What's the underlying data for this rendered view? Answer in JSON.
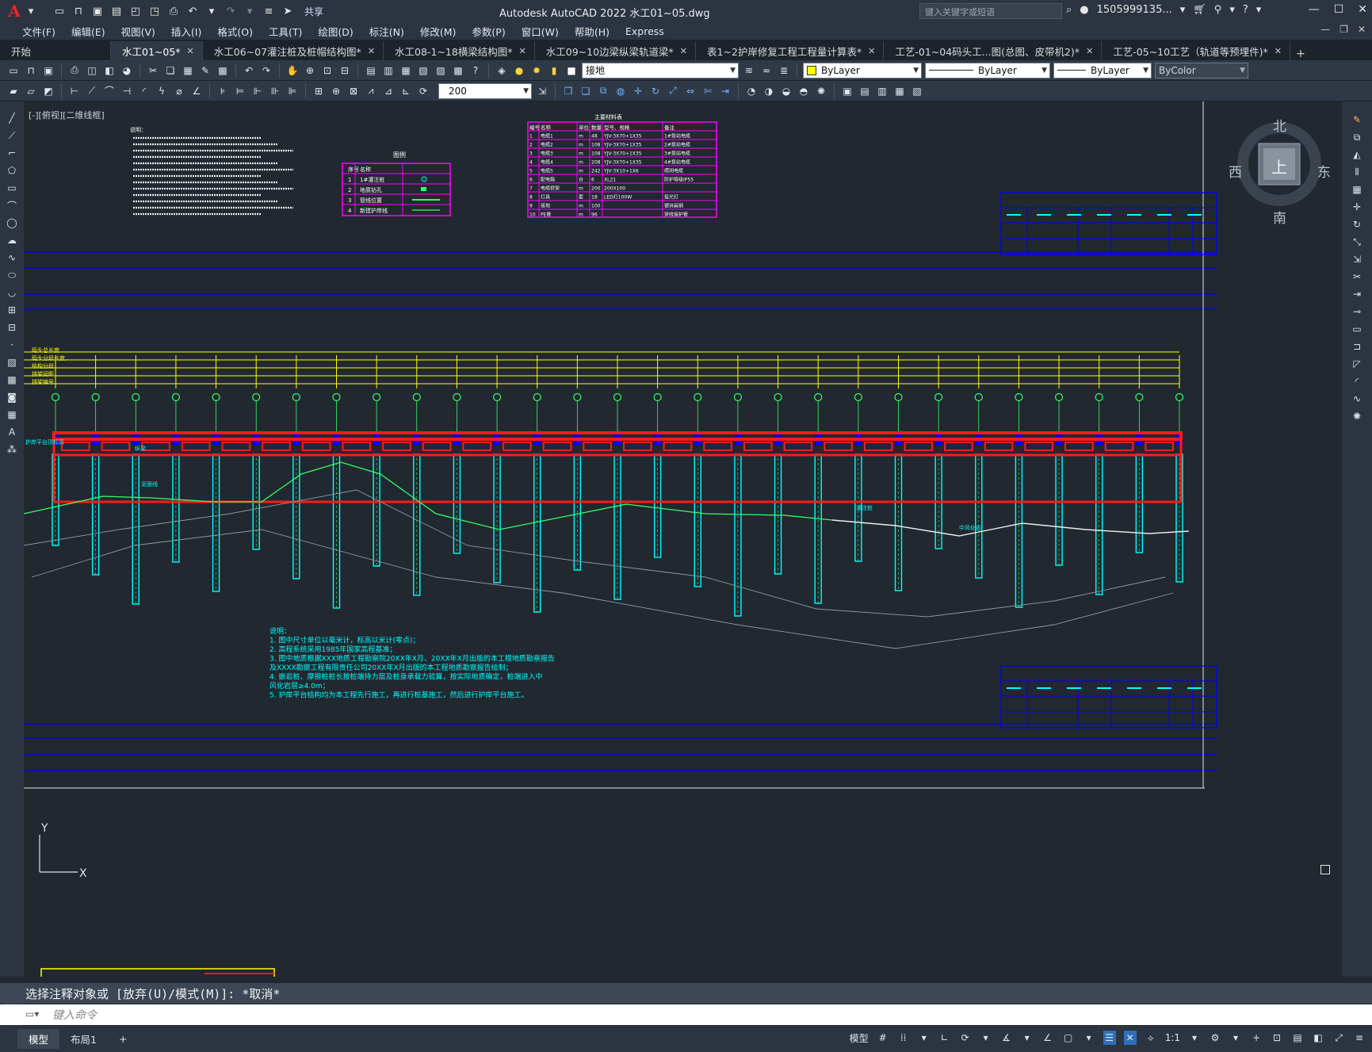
{
  "app": {
    "logo": "A",
    "title": "Autodesk AutoCAD 2022    水工01~05.dwg",
    "share": "共享",
    "search_placeholder": "键入关键字或短语",
    "user": "1505999135...",
    "cart_icon": "cart-icon",
    "help_icon": "help-icon"
  },
  "menus": [
    "文件(F)",
    "编辑(E)",
    "视图(V)",
    "插入(I)",
    "格式(O)",
    "工具(T)",
    "绘图(D)",
    "标注(N)",
    "修改(M)",
    "参数(P)",
    "窗口(W)",
    "帮助(H)",
    "Express"
  ],
  "tabs": [
    {
      "label": "开始",
      "active": false,
      "closable": false
    },
    {
      "label": "水工01~05*",
      "active": true,
      "closable": true
    },
    {
      "label": "水工06~07灌注桩及桩帽结构图*",
      "active": false,
      "closable": true
    },
    {
      "label": "水工08-1~18横梁结构图*",
      "active": false,
      "closable": true
    },
    {
      "label": "水工09~10边梁纵梁轨道梁*",
      "active": false,
      "closable": true
    },
    {
      "label": "表1~2护岸修复工程工程量计算表*",
      "active": false,
      "closable": true
    },
    {
      "label": "工艺-01~04码头工...图(总图、皮带机2)*",
      "active": false,
      "closable": true
    },
    {
      "label": "工艺-05~10工艺（轨道等预埋件)*",
      "active": false,
      "closable": true
    }
  ],
  "toolbar": {
    "layer": "接地",
    "color": "ByLayer",
    "linetype": "ByLayer",
    "lineweight": "ByLayer",
    "plotstyle": "ByColor",
    "dimscale": "200"
  },
  "viewport": {
    "label": "[-][俯视][二维线框]",
    "compass": {
      "north": "北",
      "south": "南",
      "east": "东",
      "west": "西",
      "top": "上"
    },
    "ucs": {
      "x": "X",
      "y": "Y"
    }
  },
  "drawing": {
    "notes_title": "说明：",
    "notes_bottom": [
      "说明：",
      "1. 图中尺寸单位以毫米计，标高以米计(零点)；",
      "2. 高程系统采用1985年国家高程基准；",
      "3. 图中地质根据XXX地质工程勘察院20XX年X月、20XX年X月出版的本工程地质勘察报告",
      "   及XXXX勘察工程有限责任公司20XX年X月出版的本工程地质勘察报告绘制；",
      "4. 嵌岩桩、摩擦桩桩长按桩端持力层及桩身承载力验算，按实际地质确定，桩端进入中",
      "   风化岩层≥4.0m；",
      "5. 护岸平台结构均为本工程先行施工，再进行桩基施工，然后进行护岸平台施工。"
    ],
    "legend_title": "图例",
    "legend": [
      {
        "no": "序号",
        "name": "名称",
        "symbol": "图例"
      },
      {
        "no": "1",
        "name": "1#灌注桩",
        "symbol": ""
      },
      {
        "no": "2",
        "name": "地质钻孔",
        "symbol": ""
      },
      {
        "no": "3",
        "name": "管线位置",
        "symbol": ""
      },
      {
        "no": "4",
        "name": "新建护岸线",
        "symbol": ""
      }
    ],
    "table_title": "主要材料表",
    "table_headers": [
      "编号",
      "名称",
      "单位",
      "数量",
      "型号、规格",
      "备注"
    ],
    "table_rows": [
      [
        "1",
        "电缆1",
        "m",
        "48",
        "YJV-3X70+1X35",
        "1#泵站电缆"
      ],
      [
        "2",
        "电缆2",
        "m",
        "108",
        "YJV-3X70+1X35",
        "2#泵站电缆"
      ],
      [
        "3",
        "电缆3",
        "m",
        "108",
        "YJV-3X70+1X35",
        "3#泵站电缆"
      ],
      [
        "4",
        "电缆4",
        "m",
        "208",
        "YJV-3X70+1X35",
        "4#泵站电缆"
      ],
      [
        "5",
        "电缆5",
        "m",
        "242",
        "YJV-3X10+1X6",
        "照明电缆"
      ],
      [
        "6",
        "配电箱",
        "台",
        "6",
        "XL21",
        "防护等级IP55"
      ],
      [
        "7",
        "电缆桥架",
        "m",
        "200",
        "200X100",
        ""
      ],
      [
        "8",
        "灯具",
        "套",
        "18",
        "LED灯100W",
        "投光灯"
      ],
      [
        "9",
        "接地",
        "m",
        "100",
        "",
        "镀锌扁钢"
      ],
      [
        "10",
        "PE管",
        "m",
        "96",
        "",
        "穿线保护管"
      ]
    ],
    "dim_labels": [
      "码头总长度",
      "码头分段长度",
      "结构分段",
      "排架间距",
      "排架编号"
    ],
    "bent_count": 29,
    "labels": {
      "platform_top": "护岸平台顶标高",
      "pile_label": "灌注桩",
      "beam_label": "纵梁",
      "rock_label": "中风化岩",
      "bottom_label": "泥面线"
    }
  },
  "command": {
    "history": "选择注释对象或 [放弃(U)/模式(M)]: *取消*",
    "placeholder": "键入命令"
  },
  "status": {
    "tabs": [
      "模型",
      "布局1"
    ],
    "scale": "1:1"
  },
  "colors": {
    "canvas": "#212830",
    "red": "#ff1a1a",
    "yellow": "#ffff00",
    "cyan": "#00ffff",
    "green": "#33ff66",
    "blue": "#0000ff",
    "magenta": "#ff00ff"
  }
}
